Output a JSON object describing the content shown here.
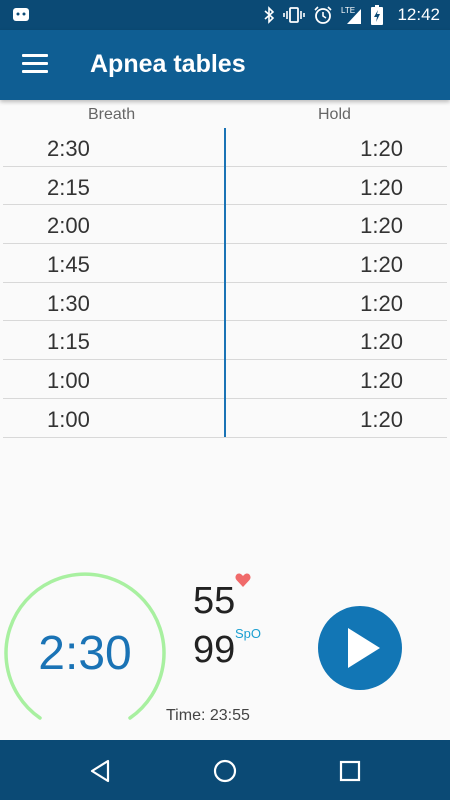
{
  "status_bar": {
    "time": "12:42",
    "network": "LTE",
    "icons": [
      "android-icon",
      "bluetooth-icon",
      "vibrate-icon",
      "alarm-icon",
      "signal-icon",
      "battery-charging-icon"
    ]
  },
  "app_bar": {
    "title": "Apnea tables",
    "menu_icon": "hamburger-menu-icon"
  },
  "table": {
    "headers": {
      "breath": "Breath",
      "hold": "Hold"
    },
    "rows": [
      {
        "breath": "2:30",
        "hold": "1:20"
      },
      {
        "breath": "2:15",
        "hold": "1:20"
      },
      {
        "breath": "2:00",
        "hold": "1:20"
      },
      {
        "breath": "1:45",
        "hold": "1:20"
      },
      {
        "breath": "1:30",
        "hold": "1:20"
      },
      {
        "breath": "1:15",
        "hold": "1:20"
      },
      {
        "breath": "1:00",
        "hold": "1:20"
      },
      {
        "breath": "1:00",
        "hold": "1:20"
      }
    ]
  },
  "timer": {
    "value": "2:30",
    "ring_color": "#a8f0a0"
  },
  "vitals": {
    "pulse": "55",
    "spo2": "99",
    "spo2_label": "SpO",
    "heart_color": "#f06a6a"
  },
  "total_time": "Time: 23:55",
  "colors": {
    "primary": "#0f5e93",
    "primary_dark": "#0b4a75",
    "accent": "#1a73b5"
  },
  "navigation": {
    "back": "back-icon",
    "home": "home-icon",
    "recents": "recents-icon"
  }
}
